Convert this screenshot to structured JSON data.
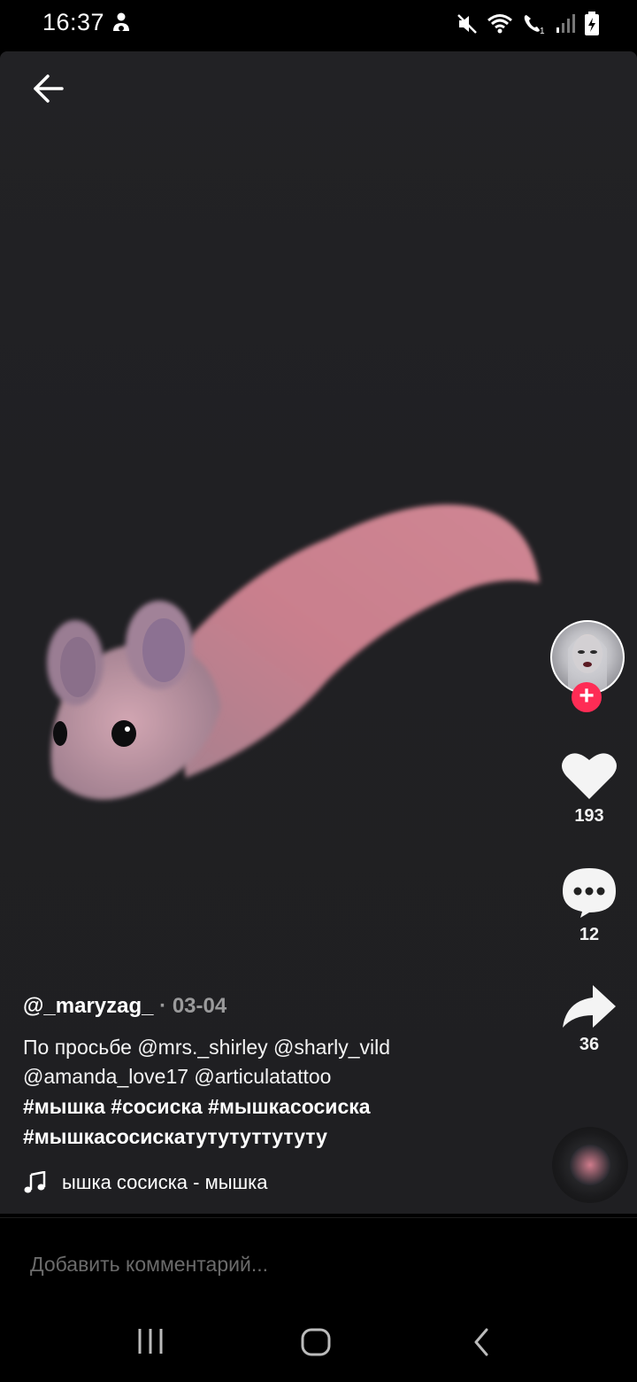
{
  "status_bar": {
    "time": "16:37",
    "left_icon": "notification-person-icon",
    "right_icons": [
      "mute-icon",
      "wifi-icon",
      "wifi-calling-icon",
      "signal-icon",
      "battery-charging-icon"
    ]
  },
  "header": {
    "back_icon": "arrow-left-icon"
  },
  "rail": {
    "follow_symbol": "+",
    "likes": "193",
    "comments": "12",
    "shares": "36",
    "accent_color": "#fe2c55"
  },
  "post": {
    "author": "@_maryzag_",
    "date_separator": "·",
    "date": "03-04",
    "description_line1": "По просьбе @mrs._shirley @sharly_vild",
    "description_line2": "@amanda_love17 @articulatattoo",
    "hashtags_line1": "#мышка #сосиска #мышкасосиска",
    "hashtags_line2": "#мышкасосискатутутуттутуту",
    "music": "ышка сосиска - мышка"
  },
  "comment": {
    "placeholder": "Добавить комментарий..."
  },
  "nav": {
    "icons": [
      "recents-icon",
      "home-icon",
      "back-icon"
    ]
  }
}
